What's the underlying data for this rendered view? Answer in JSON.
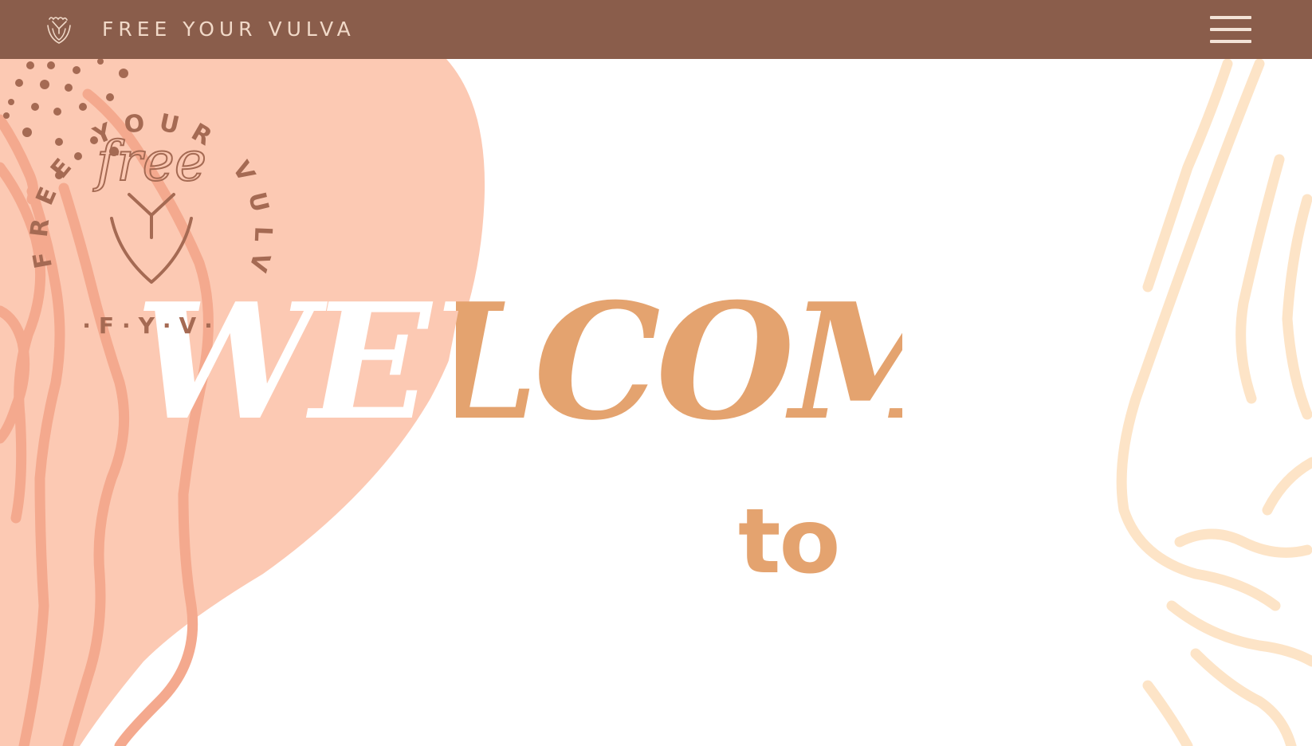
{
  "header": {
    "brand": "FREE YOUR VULVA",
    "logo_icon": "vulva-heart-logo-icon",
    "menu_icon": "hamburger-menu-icon"
  },
  "hero": {
    "welcome": "WELCOME",
    "to": "to",
    "badge": {
      "ring_text": "FREE YOUR VULVA",
      "script_text": "free",
      "initials": "·F·Y·V·"
    }
  },
  "colors": {
    "header_bg": "#8a5d4b",
    "brand_text": "#f1d9c8",
    "peach_blob": "#fcc9b3",
    "salmon_lines": "#f4a98e",
    "dots": "#a56a53",
    "welcome_white": "#ffffff",
    "welcome_tan": "#e4a36f",
    "cream_lines": "#fde4c7",
    "badge_brown": "#a56a53"
  }
}
